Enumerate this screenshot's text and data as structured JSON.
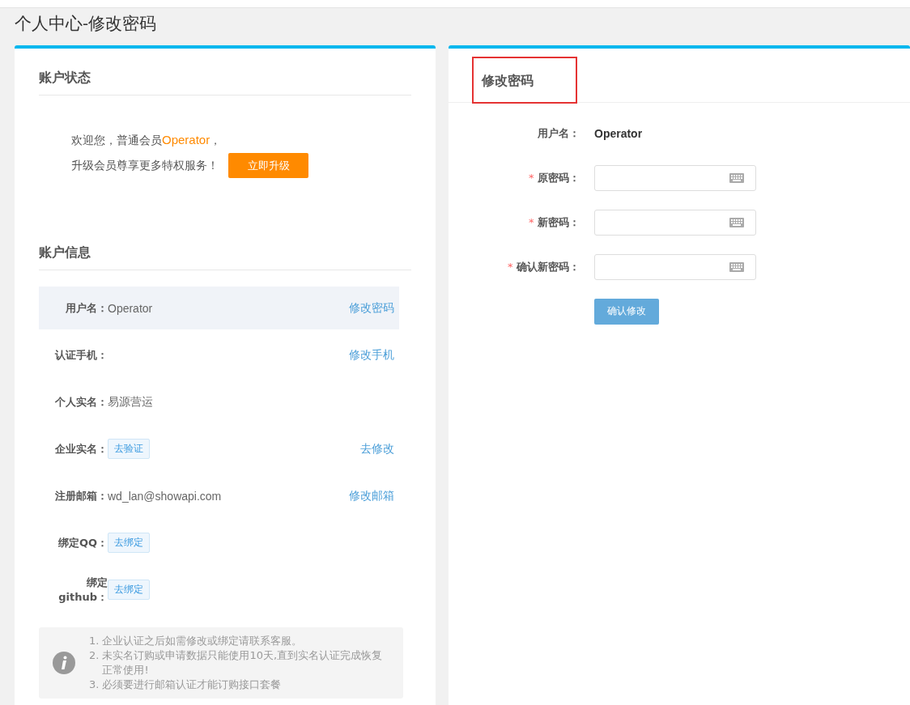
{
  "page_title": "个人中心-修改密码",
  "account_status": {
    "heading": "账户状态",
    "welcome_prefix": "欢迎您，普通会员",
    "member_name": "Operator",
    "welcome_suffix": "，",
    "upgrade_text": "升级会员尊享更多特权服务！",
    "upgrade_button": "立即升级"
  },
  "account_info": {
    "heading": "账户信息",
    "rows": [
      {
        "label": "用户名：",
        "value": "Operator",
        "kind": "text",
        "action": "修改密码",
        "highlighted": true
      },
      {
        "label": "认证手机：",
        "action": "修改手机",
        "highlighted": false
      },
      {
        "label": "个人实名：",
        "value": "易源营运",
        "kind": "text",
        "highlighted": false
      },
      {
        "label": "企业实名：",
        "value": "去验证",
        "kind": "tag",
        "action": "去修改",
        "highlighted": false
      },
      {
        "label": "注册邮箱：",
        "value": "wd_lan@showapi.com",
        "kind": "text",
        "action": "修改邮箱",
        "highlighted": false
      },
      {
        "label": "绑定QQ：",
        "value": "去绑定",
        "kind": "tag",
        "highlighted": false
      },
      {
        "label": "绑定github：",
        "value": "去绑定",
        "kind": "tag",
        "highlighted": false
      }
    ]
  },
  "notes": [
    {
      "number": "1.",
      "text": "企业认证之后如需修改或绑定请联系客服。"
    },
    {
      "number": "2.",
      "text": "未实名订购或申请数据只能使用10天,直到实名认证完成恢复正常使用!"
    },
    {
      "number": "3.",
      "text": "必须要进行邮箱认证才能订购接口套餐"
    }
  ],
  "change_password": {
    "heading": "修改密码",
    "heading_marked": true,
    "username_label": "用户名：",
    "username": "Operator",
    "fields": [
      {
        "label": "原密码：",
        "required": true,
        "required_mark": "*"
      },
      {
        "label": "新密码：",
        "required": true,
        "required_mark": "*"
      },
      {
        "label": "确认新密码：",
        "required": true,
        "required_mark": "*"
      }
    ],
    "submit_button": "确认修改"
  }
}
